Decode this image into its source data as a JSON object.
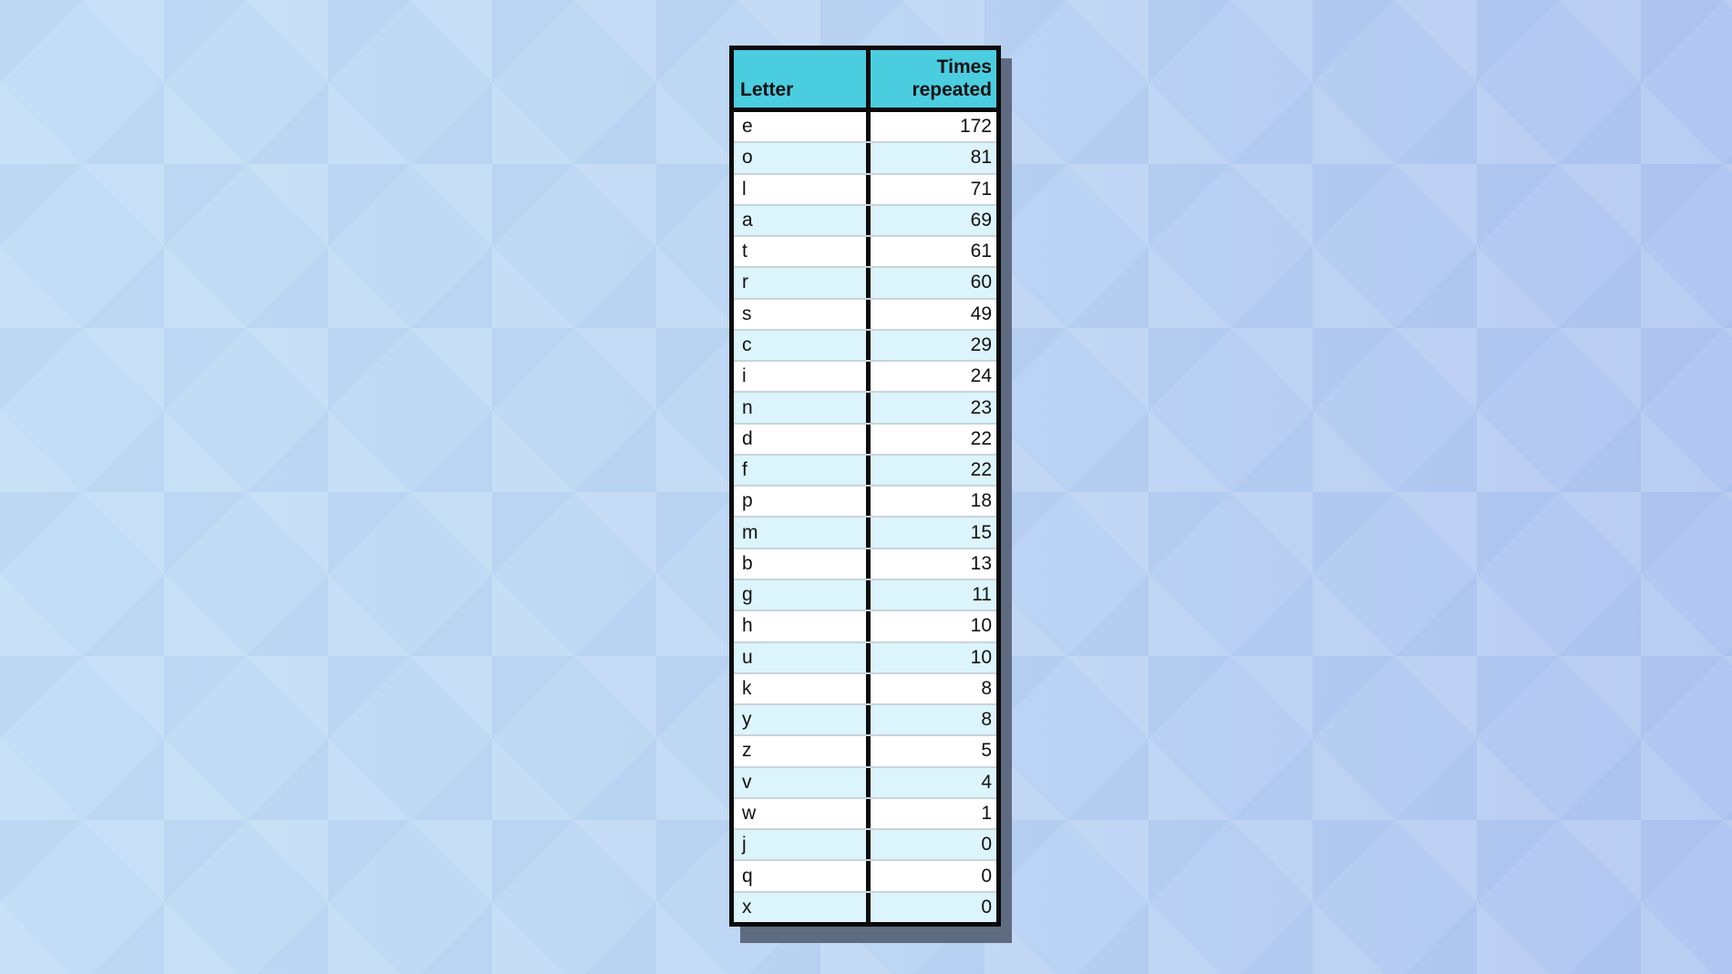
{
  "table": {
    "headers": {
      "letter": "Letter",
      "times_line1": "Times",
      "times_line2": "repeated"
    },
    "rows": [
      {
        "letter": "e",
        "count": "172"
      },
      {
        "letter": "o",
        "count": "81"
      },
      {
        "letter": "l",
        "count": "71"
      },
      {
        "letter": "a",
        "count": "69"
      },
      {
        "letter": "t",
        "count": "61"
      },
      {
        "letter": "r",
        "count": "60"
      },
      {
        "letter": "s",
        "count": "49"
      },
      {
        "letter": "c",
        "count": "29"
      },
      {
        "letter": "i",
        "count": "24"
      },
      {
        "letter": "n",
        "count": "23"
      },
      {
        "letter": "d",
        "count": "22"
      },
      {
        "letter": "f",
        "count": "22"
      },
      {
        "letter": "p",
        "count": "18"
      },
      {
        "letter": "m",
        "count": "15"
      },
      {
        "letter": "b",
        "count": "13"
      },
      {
        "letter": "g",
        "count": "11"
      },
      {
        "letter": "h",
        "count": "10"
      },
      {
        "letter": "u",
        "count": "10"
      },
      {
        "letter": "k",
        "count": "8"
      },
      {
        "letter": "y",
        "count": "8"
      },
      {
        "letter": "z",
        "count": "5"
      },
      {
        "letter": "v",
        "count": "4"
      },
      {
        "letter": "w",
        "count": "1"
      },
      {
        "letter": "j",
        "count": "0"
      },
      {
        "letter": "q",
        "count": "0"
      },
      {
        "letter": "x",
        "count": "0"
      }
    ]
  },
  "colors": {
    "header_bg": "#4bcde0",
    "row_alt_bg": "#dcf4fb",
    "border": "#0a0a0a",
    "shadow": "#5f6b80"
  }
}
